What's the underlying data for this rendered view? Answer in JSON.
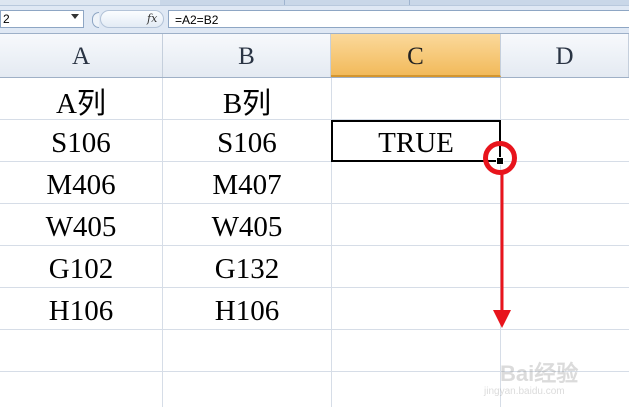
{
  "formula_bar": {
    "name_box": "2",
    "fx_label": "fx",
    "formula": "=A2=B2"
  },
  "columns": [
    "A",
    "B",
    "C",
    "D"
  ],
  "active_column": "C",
  "rows": [
    {
      "a": "A列",
      "b": "B列",
      "c": ""
    },
    {
      "a": "S106",
      "b": "S106",
      "c": "TRUE"
    },
    {
      "a": "M406",
      "b": "M407",
      "c": ""
    },
    {
      "a": "W405",
      "b": "W405",
      "c": ""
    },
    {
      "a": "G102",
      "b": "G132",
      "c": ""
    },
    {
      "a": "H106",
      "b": "H106",
      "c": ""
    }
  ],
  "annotation": {
    "color": "#e8141c",
    "icon": "circle-and-down-arrow"
  },
  "watermark": {
    "brand": "Bai经验",
    "url": "jingyan.baidu.com"
  }
}
